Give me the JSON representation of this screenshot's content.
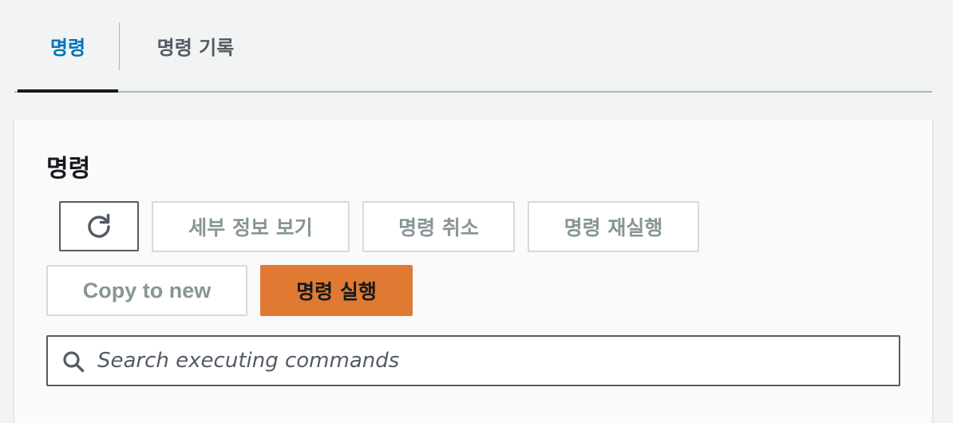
{
  "tabs": {
    "commands_label": "명령",
    "history_label": "명령 기록"
  },
  "panel": {
    "title": "명령"
  },
  "toolbar": {
    "refresh_icon": "refresh-icon",
    "details_label": "세부 정보 보기",
    "cancel_label": "명령 취소",
    "rerun_label": "명령 재실행",
    "copy_label": "Copy to new",
    "run_label": "명령 실행"
  },
  "search": {
    "icon": "search-icon",
    "placeholder": "Search executing commands",
    "value": ""
  },
  "colors": {
    "active_tab": "#0073bb",
    "primary_button": "#e07a32",
    "disabled_text": "#879596",
    "background": "#f2f3f3"
  }
}
